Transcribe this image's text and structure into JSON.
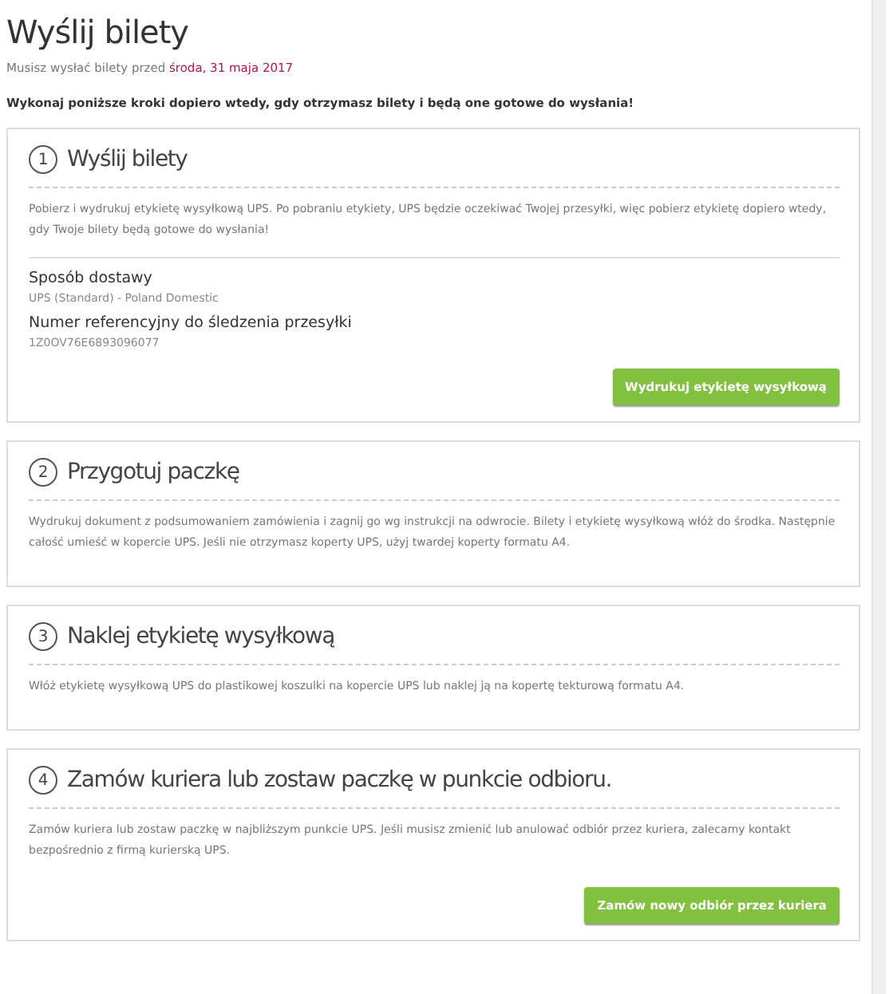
{
  "page": {
    "title": "Wyślij bilety",
    "deadline_prefix": "Musisz wysłać bilety przed",
    "deadline_date": "środa, 31 maja 2017",
    "instruction": "Wykonaj poniższe kroki dopiero wtedy, gdy otrzymasz bilety i będą one gotowe do wysłania!"
  },
  "steps": [
    {
      "number": "1",
      "title": "Wyślij bilety",
      "text": "Pobierz i wydrukuj etykietę wysyłkową UPS. Po pobraniu etykiety, UPS będzie oczekiwać Twojej przesyłki, więc pobierz etykietę dopiero wtedy, gdy Twoje bilety będą gotowe do wysłania!",
      "details": [
        {
          "label": "Sposób dostawy",
          "value": "UPS (Standard) - Poland Domestic"
        },
        {
          "label": "Numer referencyjny do śledzenia przesyłki",
          "value": "1Z0OV76E6893096077"
        }
      ],
      "button": "Wydrukuj etykietę wysyłkową"
    },
    {
      "number": "2",
      "title": "Przygotuj paczkę",
      "text": "Wydrukuj dokument z podsumowaniem zamówienia i zagnij go wg instrukcji na odwrocie. Bilety i etykietę wysyłkową włóż do środka. Następnie całość umieść w kopercie UPS. Jeśli nie otrzymasz koperty UPS, użyj twardej koperty formatu A4."
    },
    {
      "number": "3",
      "title": "Naklej etykietę wysyłkową",
      "text": "Włóż etykietę wysyłkową UPS do plastikowej koszulki na kopercie UPS lub naklej ją na kopertę tekturową formatu A4."
    },
    {
      "number": "4",
      "title": "Zamów kuriera lub zostaw paczkę w punkcie odbioru.",
      "text": "Zamów kuriera lub zostaw paczkę w najbliższym punkcie UPS. Jeśli musisz zmienić lub anulować odbiór przez kuriera, zalecamy kontakt bezpośrednio z firmą kurierską UPS.",
      "button": "Zamów nowy odbiór przez kuriera"
    }
  ]
}
